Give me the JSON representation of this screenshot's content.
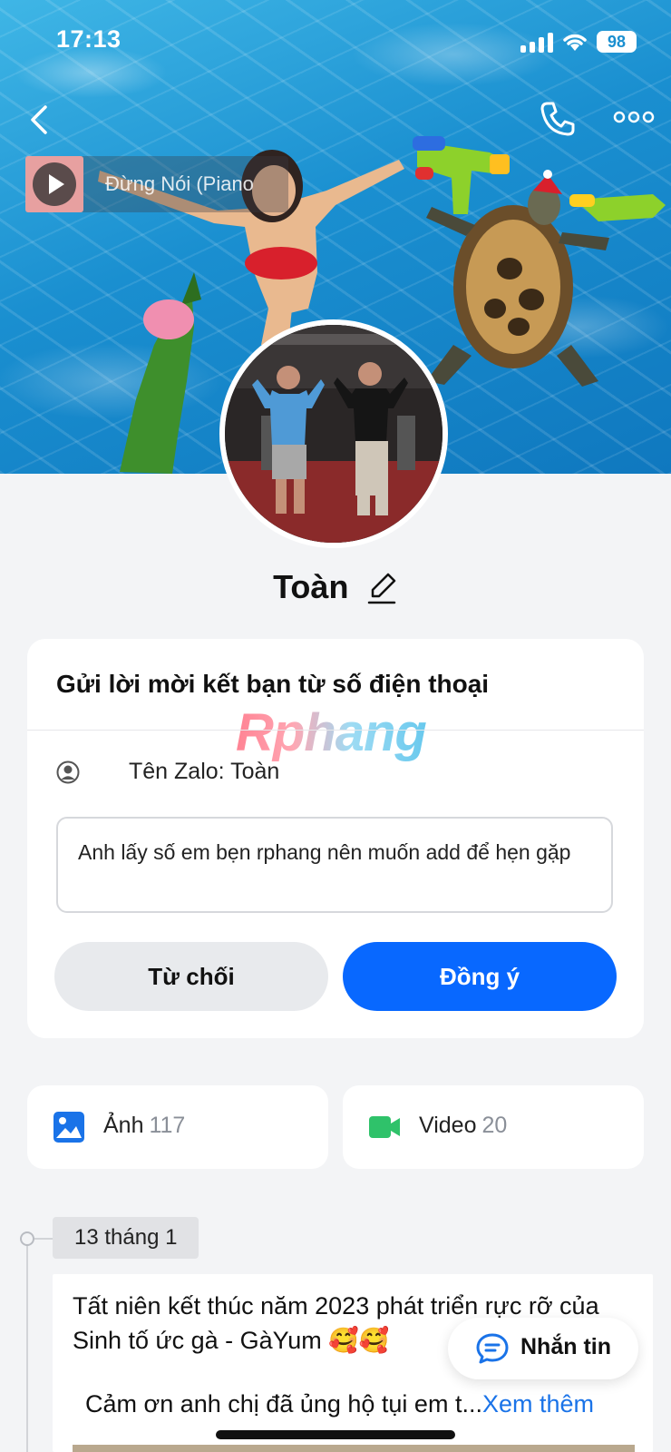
{
  "status_bar": {
    "time": "17:13",
    "battery": "98"
  },
  "music": {
    "title": "Đừng Nói (Piano"
  },
  "profile": {
    "name": "Toàn"
  },
  "request_card": {
    "title": "Gửi lời mời kết bạn từ số điện thoại",
    "watermark": "Rphang",
    "zalo_name": "Tên Zalo: Toàn",
    "message": "Anh lấy số em bẹn rphang nên muốn add để hẹn gặp",
    "decline_label": "Từ chối",
    "accept_label": "Đồng ý"
  },
  "media": {
    "photos": {
      "label": "Ảnh",
      "count": "117"
    },
    "videos": {
      "label": "Video",
      "count": "20"
    }
  },
  "timeline": {
    "date": "13 tháng 1",
    "post_text": "Tất niên kết thúc năm 2023 phát triển rực rỡ của Sinh tố ức gà - GàYum 🥰🥰",
    "post_more": "Cảm ơn anh chị đã ủng hộ tụi em t...",
    "see_more": "Xem thêm"
  },
  "fab": {
    "label": "Nhắn tin"
  },
  "colors": {
    "accent": "#0868ff",
    "link": "#1a73e8",
    "video_icon": "#2fc26a",
    "photo_icon": "#1a73e8"
  },
  "icons": [
    "back-icon",
    "phone-icon",
    "more-icon",
    "play-icon",
    "edit-icon",
    "user-circle-icon",
    "image-icon",
    "video-camera-icon",
    "chat-bubble-icon"
  ]
}
